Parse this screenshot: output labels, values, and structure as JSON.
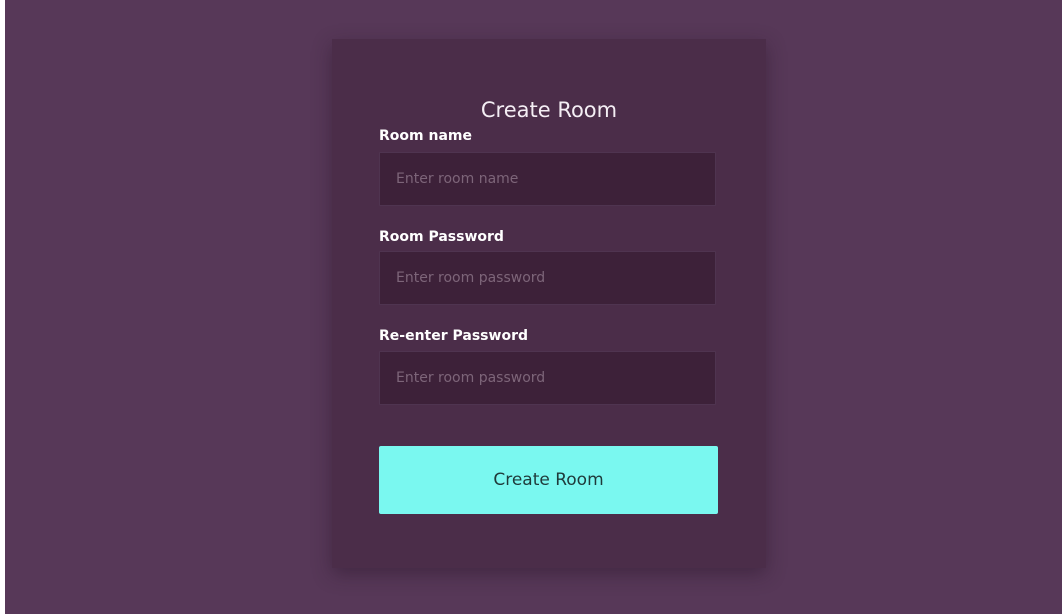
{
  "form": {
    "title": "Create Room",
    "fields": [
      {
        "label": "Room name",
        "placeholder": "Enter room name",
        "value": ""
      },
      {
        "label": "Room Password",
        "placeholder": "Enter room password",
        "value": ""
      },
      {
        "label": "Re-enter Password",
        "placeholder": "Enter room password",
        "value": ""
      }
    ],
    "submit_label": "Create Room"
  },
  "colors": {
    "background": "#573858",
    "card": "#4b2d49",
    "input": "#3d2139",
    "button": "#7af8f0"
  }
}
